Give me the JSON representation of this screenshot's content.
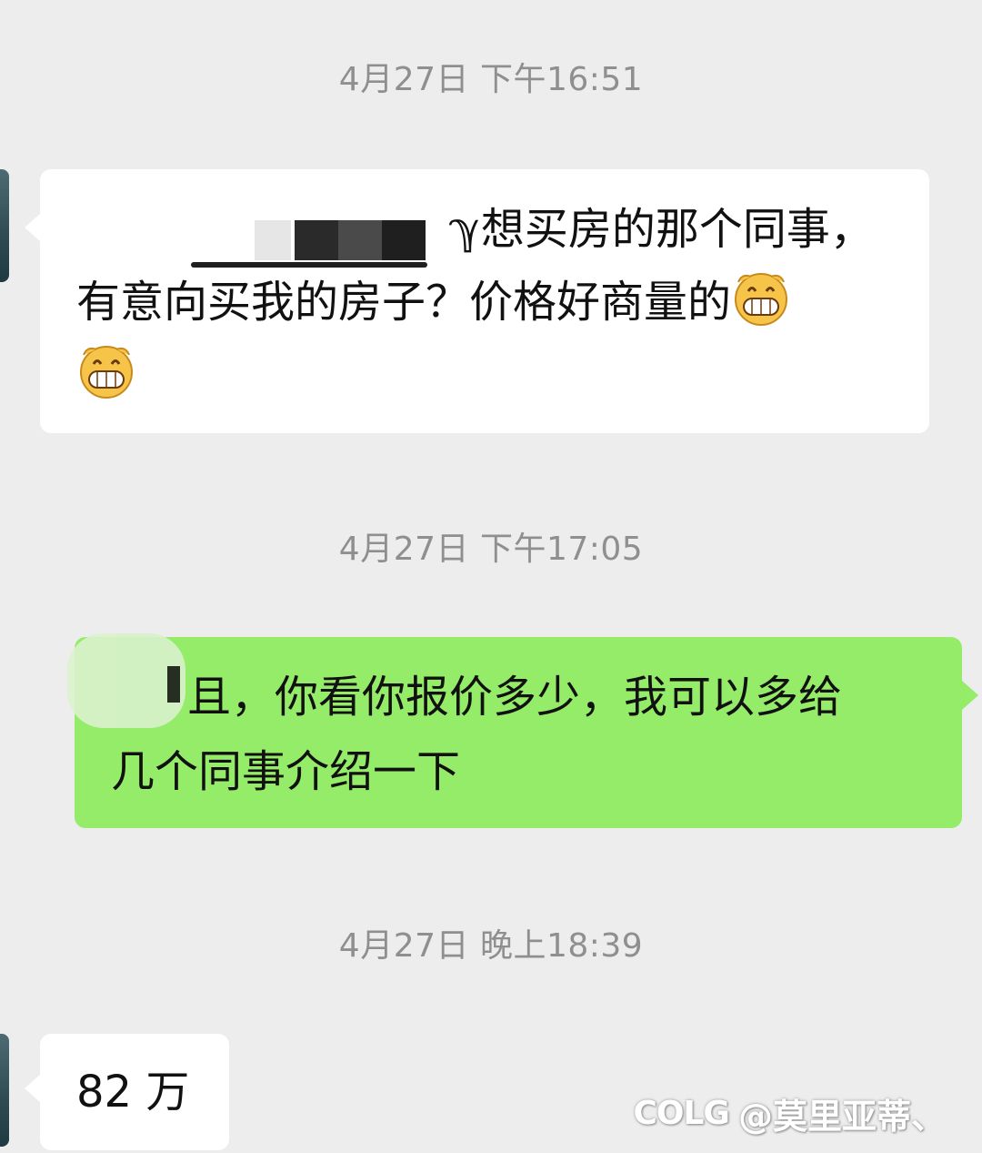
{
  "messages": [
    {
      "type": "timestamp",
      "text": "4月27日 下午16:51"
    },
    {
      "type": "incoming",
      "line1_visible": "ℽ想买房的那个同事，",
      "line2": "有意向买我的房子？价格好商量的",
      "emojis": [
        "grinning-face-emoji",
        "grinning-face-emoji"
      ]
    },
    {
      "type": "timestamp",
      "text": "4月27日 下午17:05"
    },
    {
      "type": "outgoing",
      "line1_visible": "且，你看你报价多少，我可以多给",
      "line2": "几个同事介绍一下"
    },
    {
      "type": "timestamp",
      "text": "4月27日 晚上18:39"
    },
    {
      "type": "incoming",
      "text": "82 万"
    }
  ],
  "watermark": {
    "logo": "COLG",
    "handle": "@莫里亚蒂、"
  },
  "colors": {
    "background": "#ededed",
    "incoming_bubble": "#ffffff",
    "outgoing_bubble": "#95ec69",
    "timestamp_text": "#8f8f8f"
  }
}
